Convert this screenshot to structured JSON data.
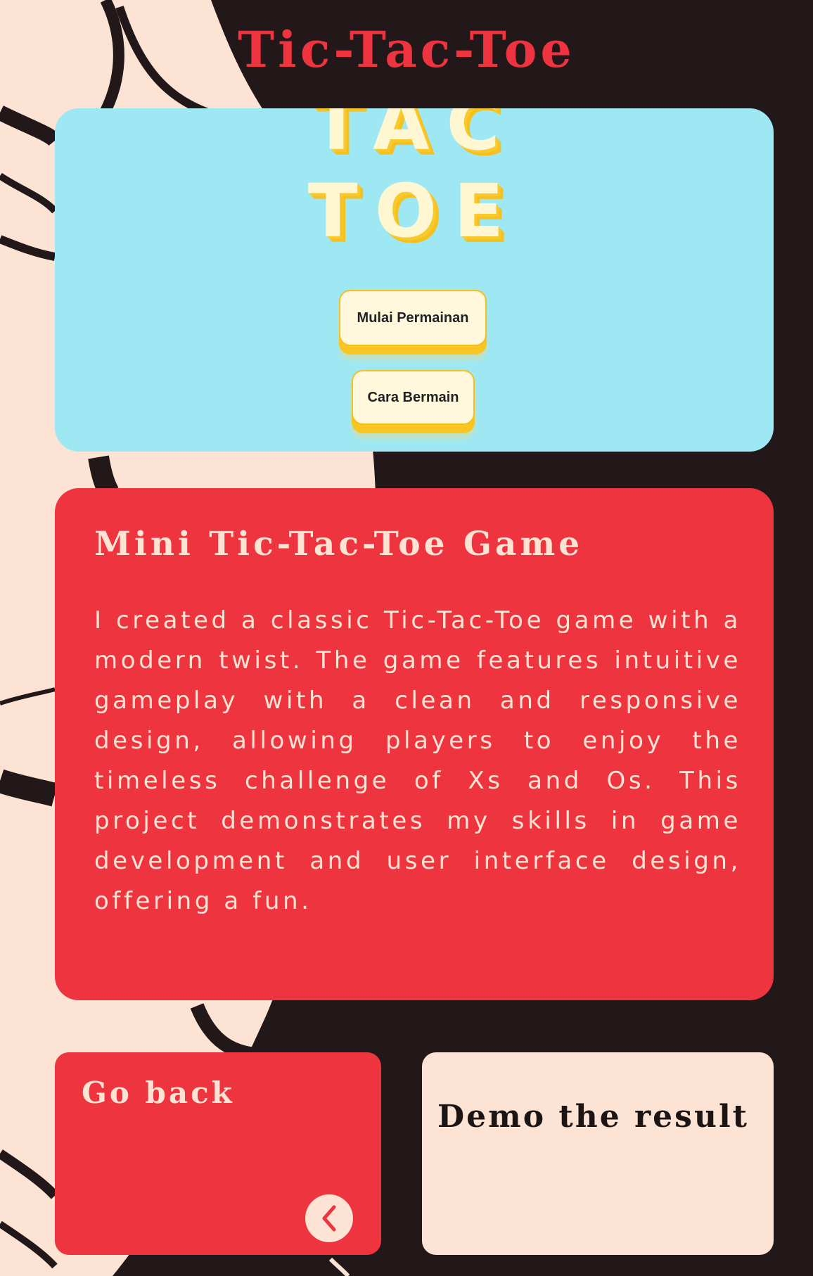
{
  "page": {
    "title": "Tic-Tac-Toe"
  },
  "hero": {
    "word_tac": "TAC",
    "word_toe": "TOE",
    "start_button": "Mulai Permainan",
    "howto_button": "Cara Bermain"
  },
  "info": {
    "heading": "Mini Tic-Tac-Toe Game",
    "description": "I created a classic Tic-Tac-Toe game with a modern twist. The game features intuitive gameplay with a clean and responsive design, allowing players to enjoy the timeless challenge of Xs and Os. This project demonstrates my skills in game development and user interface design, offering a fun."
  },
  "back": {
    "label": "Go back",
    "icon": "chevron-left-icon"
  },
  "demo": {
    "label": "Demo the result"
  },
  "colors": {
    "background": "#221819",
    "accent_red": "#ee343e",
    "cream": "#fde3d3",
    "sky": "#9ee8f4",
    "yellow": "#f8c522"
  }
}
